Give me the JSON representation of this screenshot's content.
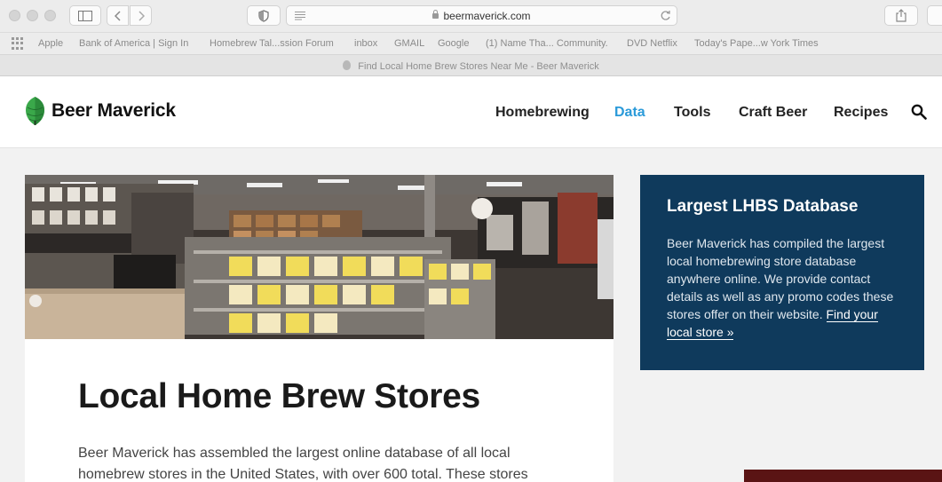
{
  "browser": {
    "url": "beermaverick.com",
    "tab_title": "Find Local Home Brew Stores Near Me - Beer Maverick",
    "favorites": [
      "Apple",
      "Bank of America | Sign In",
      "Homebrew Tal...ssion Forum",
      "inbox",
      "GMAIL",
      "Google",
      "(1) Name Tha... Community.",
      "DVD Netflix",
      "Today's Pape...w York Times"
    ]
  },
  "header": {
    "logo_text": "Beer Maverick",
    "nav": [
      "Homebrewing",
      "Data",
      "Tools",
      "Craft Beer",
      "Recipes"
    ],
    "active_nav": "Data",
    "accent_color": "#2a9ad9"
  },
  "main": {
    "title": "Local Home Brew Stores",
    "intro": "Beer Maverick has assembled the largest online database of all local homebrew stores in the United States, with over 600 total. These stores"
  },
  "sidebar": {
    "heading": "Largest LHBS Database",
    "body": "Beer Maverick has compiled the largest local homebrewing store database anywhere online. We provide contact details as well as any promo codes these stores offer on their website.",
    "link_text": "Find your local store »",
    "background_color": "#0f3a5c"
  },
  "icons": [
    "sidebar-toggle-icon",
    "back-icon",
    "forward-icon",
    "shield-icon",
    "reader-icon",
    "lock-icon",
    "reload-icon",
    "share-icon",
    "grid-icon",
    "search-icon",
    "hop-logo-icon"
  ]
}
